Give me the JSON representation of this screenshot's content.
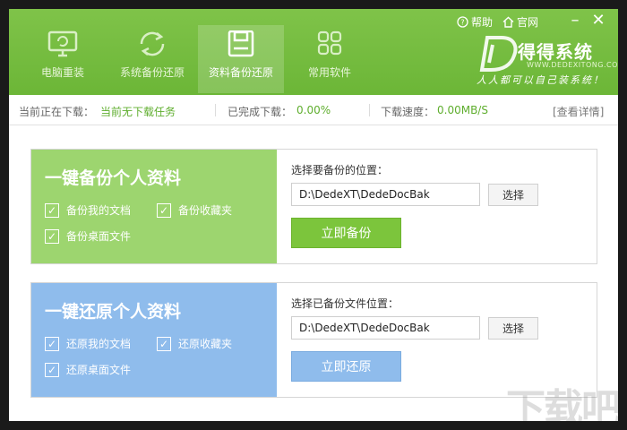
{
  "header": {
    "tabs": [
      {
        "label": "电脑重装",
        "icon": "monitor-icon",
        "active": false
      },
      {
        "label": "系统备份还原",
        "icon": "refresh-icon",
        "active": false
      },
      {
        "label": "资料备份还原",
        "icon": "save-icon",
        "active": true
      },
      {
        "label": "常用软件",
        "icon": "apps-grid-icon",
        "active": false
      }
    ],
    "help_label": "帮助",
    "website_label": "官网",
    "logo_text": "得得系统",
    "logo_sub": "WWW.DEDEXITONG.COM",
    "slogan": "人人都可以自己装系统！"
  },
  "status": {
    "current_label": "当前正在下载：",
    "current_value": "当前无下载任务",
    "done_label": "已完成下载：",
    "done_value": "0.00%",
    "speed_label": "下载速度：",
    "speed_value": "0.00MB/S",
    "details_link": "[查看详情]"
  },
  "backup": {
    "title": "一键备份个人资料",
    "options": [
      {
        "label": "备份我的文档",
        "checked": true
      },
      {
        "label": "备份收藏夹",
        "checked": true
      },
      {
        "label": "备份桌面文件",
        "checked": true
      }
    ],
    "location_label": "选择要备份的位置：",
    "path": "D:\\DedeXT\\DedeDocBak",
    "choose_label": "选择",
    "action_label": "立即备份"
  },
  "restore": {
    "title": "一键还原个人资料",
    "options": [
      {
        "label": "还原我的文档",
        "checked": true
      },
      {
        "label": "还原收藏夹",
        "checked": true
      },
      {
        "label": "还原桌面文件",
        "checked": true
      }
    ],
    "location_label": "选择已备份文件位置：",
    "path": "D:\\DedeXT\\DedeDocBak",
    "choose_label": "选择",
    "action_label": "立即还原"
  },
  "watermark": "下载吧",
  "colors": {
    "header_green": "#6cb637",
    "backup_green": "#9dd56f",
    "restore_blue": "#8fbcec",
    "status_green": "#5fae2e"
  }
}
